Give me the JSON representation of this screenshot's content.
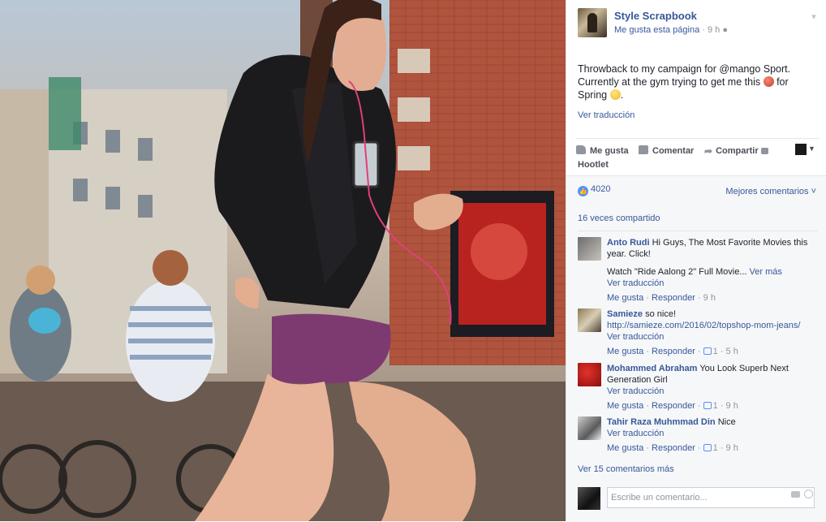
{
  "post": {
    "page_name": "Style Scrapbook",
    "like_page": "Me gusta esta página",
    "time": "9 h",
    "text_line1": "Throwback to my campaign for @mango Sport.",
    "text_line2a": "Currently at the gym trying to get me this",
    "text_line2b": "for",
    "text_line3": "Spring",
    "text_end": ".",
    "see_translation": "Ver traducción"
  },
  "actions": {
    "like": "Me gusta",
    "comment": "Comentar",
    "share": "Compartir",
    "hootlet": "Hootlet"
  },
  "stats": {
    "likes": "4020",
    "best_comments": "Mejores comentarios ˅",
    "shares": "16 veces compartido"
  },
  "comments": [
    {
      "author": "Anto Rudi",
      "text": "Hi Guys, The Most Favorite Movies this year. Click!",
      "extra": "Watch \"Ride Aalong 2\" Full Movie...",
      "see_more": "Ver más",
      "translation": "Ver traducción",
      "like": "Me gusta",
      "reply": "Responder",
      "time": "9 h"
    },
    {
      "author": "Samieze",
      "text": "so nice!",
      "link": "http://samieze.com/2016/02/topshop-mom-jeans/",
      "translation": "Ver traducción",
      "like": "Me gusta",
      "reply": "Responder",
      "reactions": "1",
      "time": "5 h"
    },
    {
      "author": "Mohammed Abraham",
      "text": "You Look Superb Next Generation Girl",
      "translation": "Ver traducción",
      "like": "Me gusta",
      "reply": "Responder",
      "reactions": "1",
      "time": "9 h"
    },
    {
      "author": "Tahir Raza Muhmmad Din",
      "text": "Nice",
      "translation": "Ver traducción",
      "like": "Me gusta",
      "reply": "Responder",
      "reactions": "1",
      "time": "9 h"
    }
  ],
  "more_comments": "Ver 15 comentarios más",
  "composer": {
    "placeholder": "Escribe un comentario..."
  },
  "colors": {
    "link": "#365899",
    "meta": "#90949c",
    "like_blue": "#5890ff"
  }
}
